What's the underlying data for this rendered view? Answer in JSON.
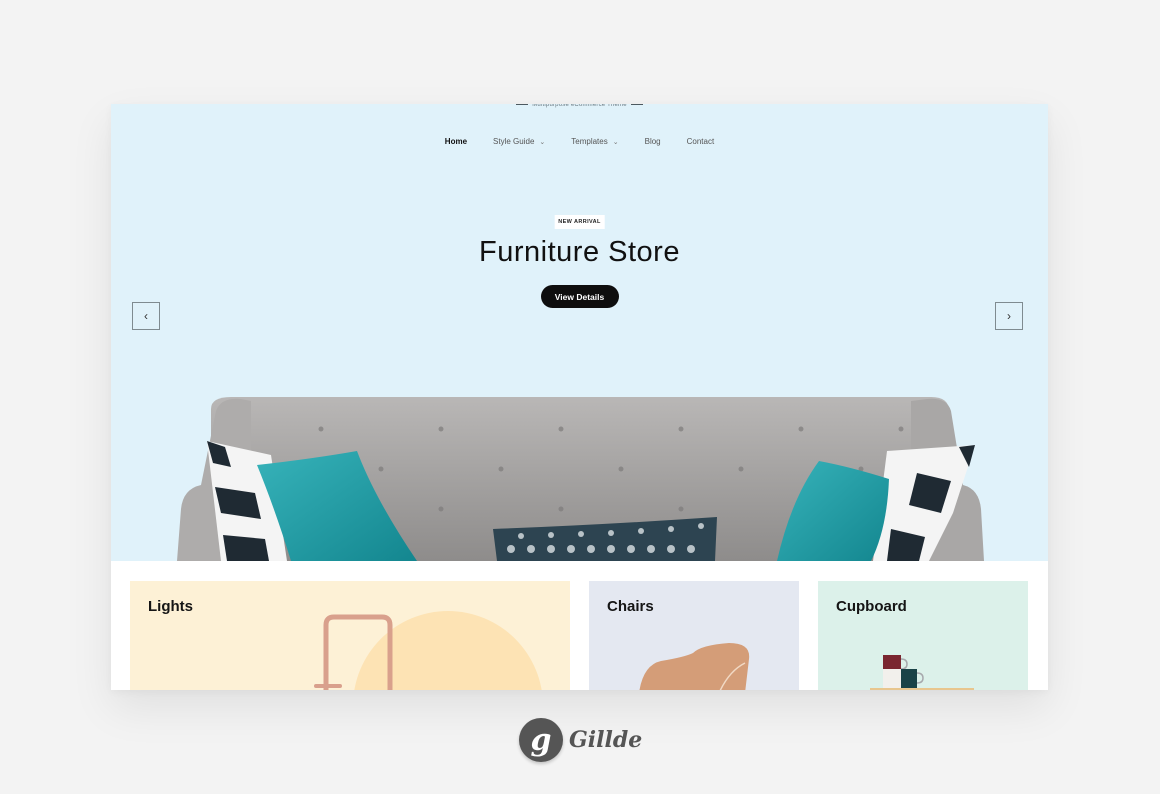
{
  "header": {
    "tagline": "Multipurpose eCommerce Theme"
  },
  "nav": {
    "items": [
      {
        "label": "Home",
        "active": true,
        "has_dropdown": false
      },
      {
        "label": "Style Guide",
        "active": false,
        "has_dropdown": true
      },
      {
        "label": "Templates",
        "active": false,
        "has_dropdown": true
      },
      {
        "label": "Blog",
        "active": false,
        "has_dropdown": false
      },
      {
        "label": "Contact",
        "active": false,
        "has_dropdown": false
      }
    ],
    "dropdown_icon": "chevron-down-icon"
  },
  "hero": {
    "badge": "NEW ARRIVAL",
    "title": "Furniture Store",
    "cta_label": "View Details",
    "prev_icon": "‹",
    "next_icon": "›",
    "image": "grey tufted sofa with teal and striped pillows",
    "background_color": "#e0f2fa"
  },
  "categories": [
    {
      "title": "Lights",
      "image": "copper floor lamp",
      "background_color": "#fdf1d6"
    },
    {
      "title": "Chairs",
      "image": "tan shell chair",
      "background_color": "#e4e8f1"
    },
    {
      "title": "Cupboard",
      "image": "stacked mugs on shelf",
      "background_color": "#dcf1ea"
    }
  ],
  "brand": {
    "mark": "g",
    "name": "Gillde"
  }
}
